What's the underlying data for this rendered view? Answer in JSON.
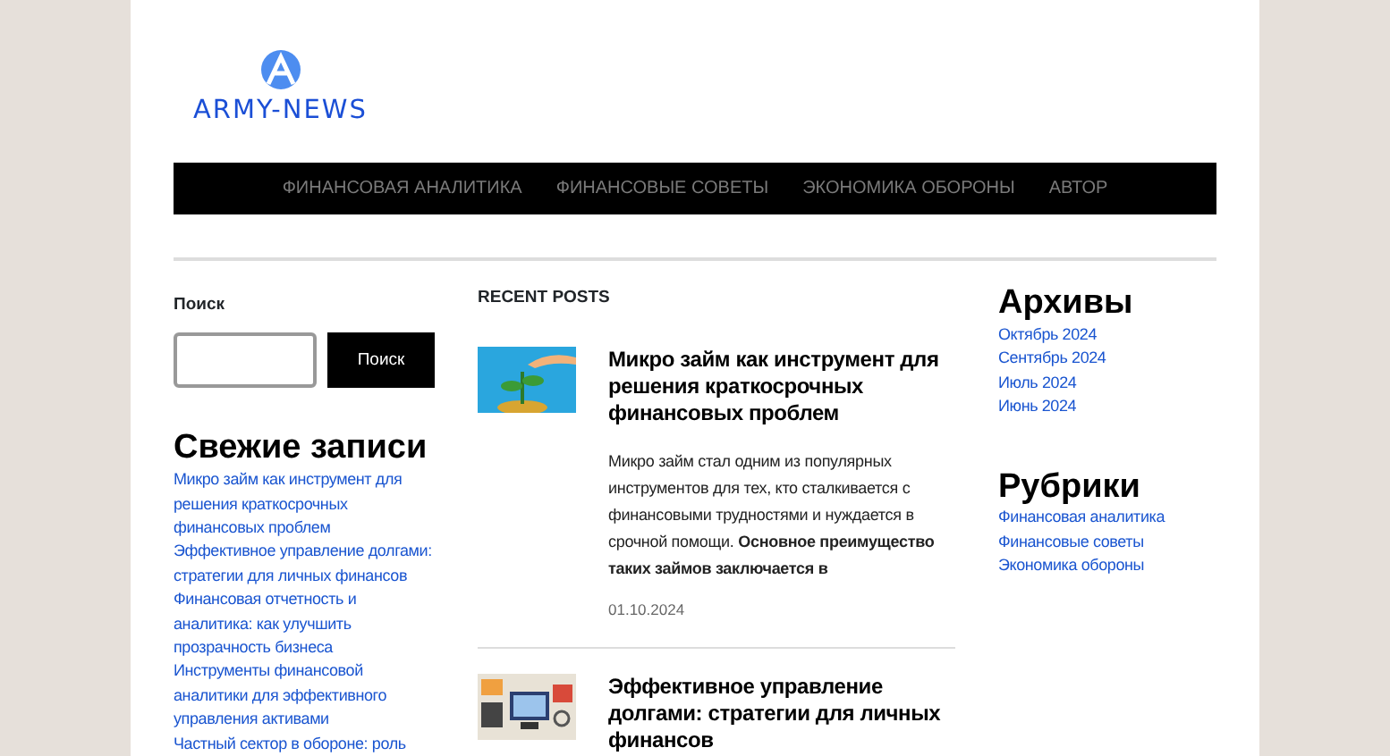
{
  "logo": {
    "text": "ARMY-NEWS"
  },
  "nav": [
    {
      "label": "ФИНАНСОВАЯ АНАЛИТИКА"
    },
    {
      "label": "ФИНАНСОВЫЕ СОВЕТЫ"
    },
    {
      "label": "ЭКОНОМИКА ОБОРОНЫ"
    },
    {
      "label": "АВТОР"
    }
  ],
  "search": {
    "label": "Поиск",
    "button": "Поиск"
  },
  "recent": {
    "title": "Свежие записи",
    "items": [
      "Микро займ как инструмент для решения краткосрочных финансовых проблем",
      "Эффективное управление долгами: стратегии для личных финансов",
      "Финансовая отчетность и аналитика: как улучшить прозрачность бизнеса",
      "Инструменты финансовой аналитики для эффективного управления активами",
      "Частный сектор в обороне: роль"
    ]
  },
  "posts_title": "RECENT POSTS",
  "posts": [
    {
      "kind": "plant",
      "title": "Микро займ как инструмент для решения краткосрочных финансовых проблем",
      "excerpt_link": "Микро займ",
      "excerpt": " стал одним из популярных инструментов для тех, кто сталкивается с финансовыми трудностями и нуждается в срочной помощи. **Основное преимущество таких займов заключается в**",
      "date": "01.10.2024"
    },
    {
      "kind": "dashboard",
      "title": "Эффективное управление долгами: стратегии для личных финансов"
    }
  ],
  "archives": {
    "title": "Архивы",
    "items": [
      "Октябрь 2024",
      "Сентябрь 2024",
      "Июль 2024",
      "Июнь 2024"
    ]
  },
  "categories": {
    "title": "Рубрики",
    "items": [
      "Финансовая аналитика",
      "Финансовые советы",
      "Экономика обороны"
    ]
  }
}
